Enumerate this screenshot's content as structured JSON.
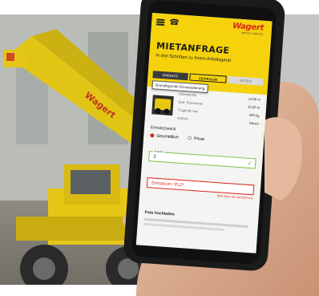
{
  "topbar": {
    "logo": "Wagert",
    "logo_sub": "MIETEN • SERVICE",
    "menu_icon": "hamburger-icon",
    "phone_icon": "phone-icon"
  },
  "hero": {
    "title": "MIETANFRAGE",
    "subtitle": "In drei Schritten zu Ihrem Arbeitsgerät",
    "steps": [
      "EINSATZ",
      "ZEITRAUM",
      "DATEN"
    ],
    "tooltip": "Grundlegende Einsatzplanung"
  },
  "spec": {
    "rows": [
      {
        "label": "Arbeitshöhe",
        "value": "14,50 m"
      },
      {
        "label": "Seitl. Reichweite",
        "value": "10,20 m"
      },
      {
        "label": "Tragkraft max",
        "value": "200 kg"
      },
      {
        "label": "Antrieb",
        "value": "Diesel"
      }
    ]
  },
  "form": {
    "einsatzzweck_label": "Einsatzzweck",
    "radio_geschaeftlich": "Geschäftlich",
    "radio_privat": "Privat",
    "anzahl_label": "Anzahl",
    "anzahl_value": "2",
    "einsatzort_placeholder": "Einsatzort / PLZ*",
    "error_message": "Bitte füllen Sie das Feld aus.",
    "foto_label": "Foto hochladen"
  },
  "colors": {
    "brand_yellow": "#f5d20c",
    "brand_red": "#d9261c",
    "success_green": "#7cc34a"
  }
}
